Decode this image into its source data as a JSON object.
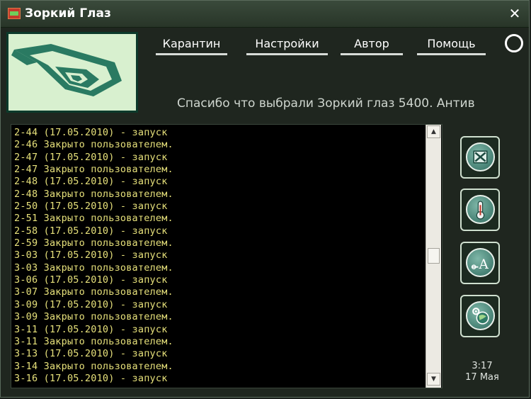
{
  "window": {
    "title": "Зоркий Глаз"
  },
  "nav": [
    {
      "label": "Карантин"
    },
    {
      "label": "Настройки"
    },
    {
      "label": "Автор"
    },
    {
      "label": "Помощь"
    }
  ],
  "ticker": "Спасибо что выбрали Зоркий глаз 5400.   Антив",
  "log": [
    "2-44 (17.05.2010) - запуск",
    "2-46 Закрыто пользователем.",
    "2-47 (17.05.2010) - запуск",
    "2-47 Закрыто пользователем.",
    "2-48 (17.05.2010) - запуск",
    "2-48 Закрыто пользователем.",
    "2-50 (17.05.2010) - запуск",
    "2-51 Закрыто пользователем.",
    "2-58 (17.05.2010) - запуск",
    "2-59 Закрыто пользователем.",
    "3-03 (17.05.2010) - запуск",
    "3-03 Закрыто пользователем.",
    "3-06 (17.05.2010) - запуск",
    "3-07 Закрыто пользователем.",
    "3-09 (17.05.2010) - запуск",
    "3-09 Закрыто пользователем.",
    "3-11 (17.05.2010) - запуск",
    "3-11 Закрыто пользователем.",
    "3-13 (17.05.2010) - запуск",
    "3-14 Закрыто пользователем.",
    "3-16 (17.05.2010) - запуск"
  ],
  "tools": [
    {
      "icon": "close-window-icon"
    },
    {
      "icon": "thermometer-icon"
    },
    {
      "icon": "text-font-icon"
    },
    {
      "icon": "globe-settings-icon"
    }
  ],
  "clock": {
    "time": "3:17",
    "date": "17 Мая"
  },
  "colors": {
    "log_text": "#e6e07a",
    "logo_bg": "#d8f0cf",
    "accent": "#2f6b5f"
  }
}
